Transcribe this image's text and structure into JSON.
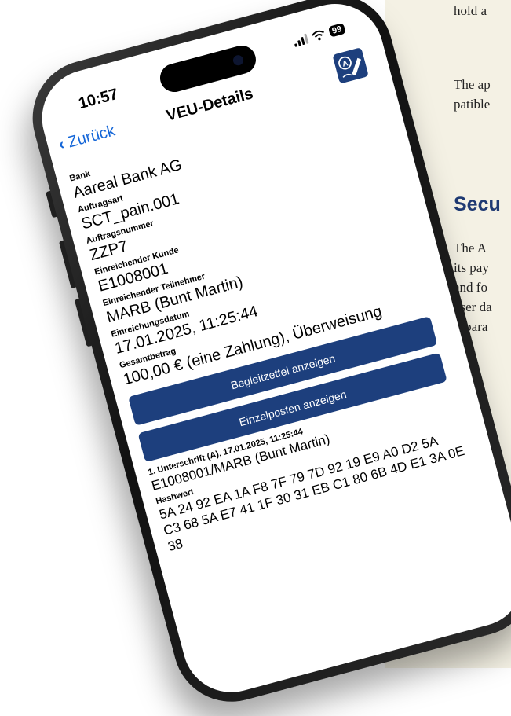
{
  "doc": {
    "line1": "hold a",
    "line2": "The ap",
    "line3": "patible",
    "heading": "Secu",
    "para": [
      "The A",
      "its pay",
      "and fo",
      "user da",
      "separa"
    ]
  },
  "status": {
    "time": "10:57",
    "battery": "99"
  },
  "nav": {
    "back_label": "Zurück",
    "title": "VEU-Details"
  },
  "fields": [
    {
      "label": "Bank",
      "value": "Aareal Bank AG"
    },
    {
      "label": "Auftragsart",
      "value": "SCT_pain.001"
    },
    {
      "label": "Auftragsnummer",
      "value": "ZZP7"
    },
    {
      "label": "Einreichender Kunde",
      "value": "E1008001"
    },
    {
      "label": "Einreichender Teilnehmer",
      "value": "MARB (Bunt Martin)"
    },
    {
      "label": "Einreichungsdatum",
      "value": "17.01.2025, 11:25:44"
    },
    {
      "label": "Gesamtbetrag",
      "value": "100,00 € (eine Zahlung), Überweisung"
    }
  ],
  "buttons": {
    "slip": "Begleitzettel anzeigen",
    "items": "Einzelposten anzeigen"
  },
  "signature": {
    "label": "1. Unterschrift (A), 17.01.2025, 11:25:44",
    "value": "E1008001/MARB (Bunt Martin)"
  },
  "hash": {
    "label": "Hashwert",
    "line1": "5A 24 92 EA 1A F8 7F 79 7D 92 19 E9 A0 D2 5A",
    "line2": "C3 68 5A E7 41 1F 30 31 EB C1 80 6B 4D E1 3A 0E",
    "line3": "38"
  },
  "icons": {
    "back": "chevron-left-icon",
    "sign": "signature-pen-icon",
    "wifi": "wifi-icon",
    "signal": "signal-icon"
  },
  "colors": {
    "accent": "#1466d8",
    "button": "#1d3f7d",
    "heading": "#1f3a73",
    "panel": "#f4f1e4"
  }
}
